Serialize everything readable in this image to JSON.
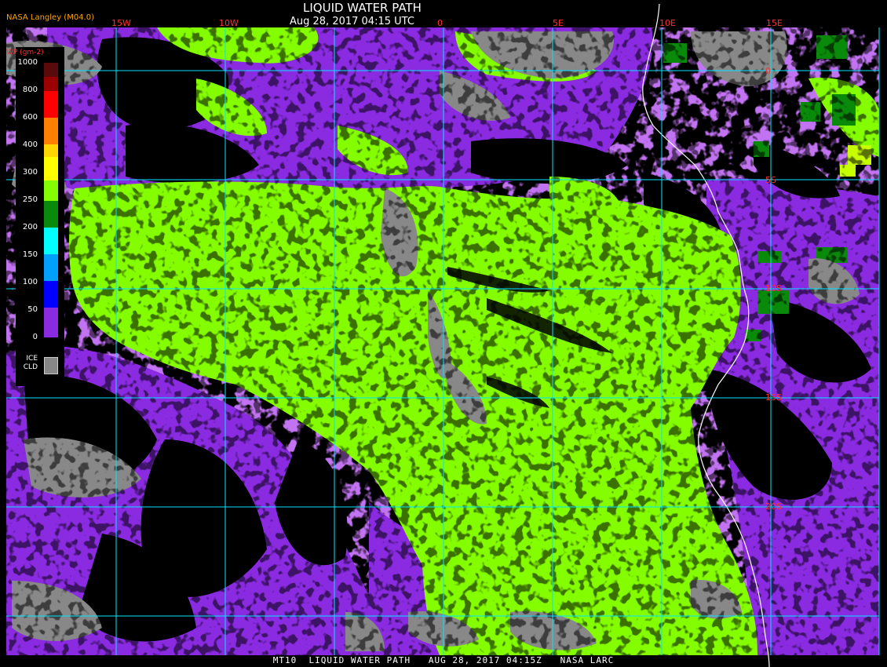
{
  "header": {
    "title": "LIQUID WATER PATH",
    "subtitle": "Aug 28, 2017 04:15 UTC",
    "credit": "NASA Langley (M04.0)"
  },
  "footer": "MT10  LIQUID WATER PATH   AUG 28, 2017 04:15Z   NASA LARC",
  "legend": {
    "title": "WP (gm-2)",
    "ticks": [
      "1000",
      "800",
      "600",
      "400",
      "300",
      "250",
      "200",
      "150",
      "100",
      "50",
      "0"
    ],
    "ice_label_1": "ICE",
    "ice_label_2": "CLD",
    "colors": [
      "#5a0a0a",
      "#9a0000",
      "#ff0000",
      "#ff7f00",
      "#ffd700",
      "#ffff00",
      "#84fd00",
      "#0a8a0a",
      "#00ffff",
      "#00a0ff",
      "#0000ff",
      "#8a2be2"
    ],
    "ice_color": "#888888"
  },
  "grid": {
    "lon_labels": [
      "15W",
      "10W",
      "0",
      "5E",
      "10E",
      "15E"
    ],
    "lat_labels": [
      "0",
      "5S",
      "10S",
      "15S",
      "20S"
    ],
    "color": "#00e5ff"
  },
  "colors": {
    "background": "#000000",
    "warm_cloud": "#84fd00",
    "thin_cloud": "#8a2be2",
    "ice_cloud": "#888888",
    "dark_green": "#0a8a0a",
    "coastline": "#ffffff"
  }
}
